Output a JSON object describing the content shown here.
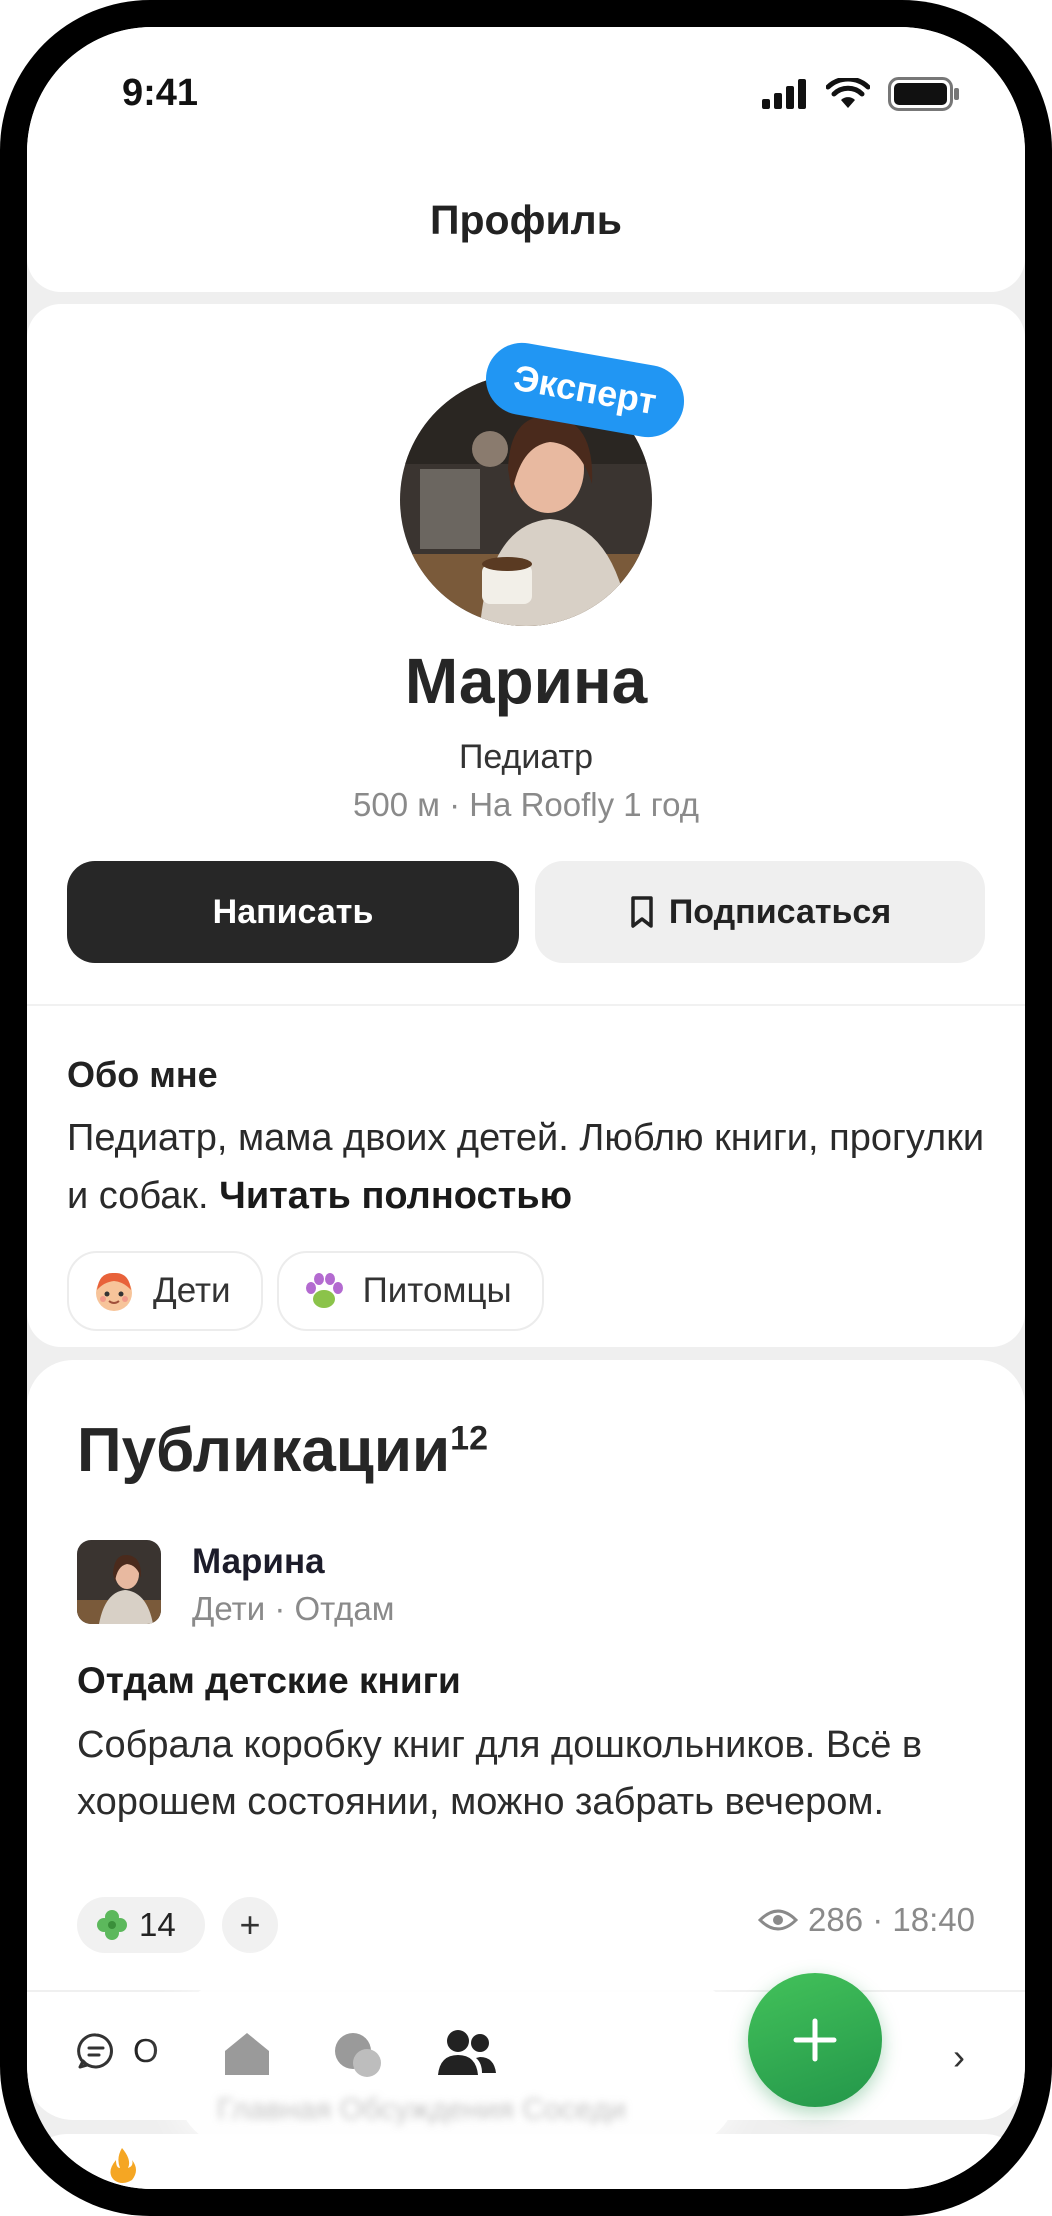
{
  "status_bar": {
    "time": "9:41"
  },
  "header": {
    "title": "Профиль"
  },
  "profile": {
    "badge": "Эксперт",
    "name": "Марина",
    "role": "Педиатр",
    "meta": "500 м · На Roofly 1 год",
    "write_button": "Написать",
    "follow_button": "Подписаться"
  },
  "about": {
    "title": "Обо мне",
    "text": "Педиатр, мама двоих детей. Люблю книги, прогулки и собак.",
    "read_more": "Читать полностью",
    "tags": [
      {
        "label": "Дети",
        "icon": "child-face-icon"
      },
      {
        "label": "Питомцы",
        "icon": "paw-icon"
      }
    ]
  },
  "publications": {
    "title": "Публикации",
    "count": "12",
    "post": {
      "author": "Марина",
      "category": "Дети · Отдам",
      "title": "Отдам детские книги",
      "text": "Собрала коробку книг для дошкольников. Всё в хорошем состоянии, можно забрать вечером.",
      "reaction_count": "14",
      "add_reaction": "+",
      "stats": "286 · 18:40",
      "comments_label": "О",
      "chevron": "›"
    }
  },
  "tabbar": {
    "items": [
      "home-icon",
      "chat-icon",
      "people-icon"
    ],
    "blurred_label": "Главная Обсуждения Соседи"
  },
  "colors": {
    "accent_green": "#23964a",
    "badge_blue": "#2196f3",
    "dark_button": "#272727"
  }
}
